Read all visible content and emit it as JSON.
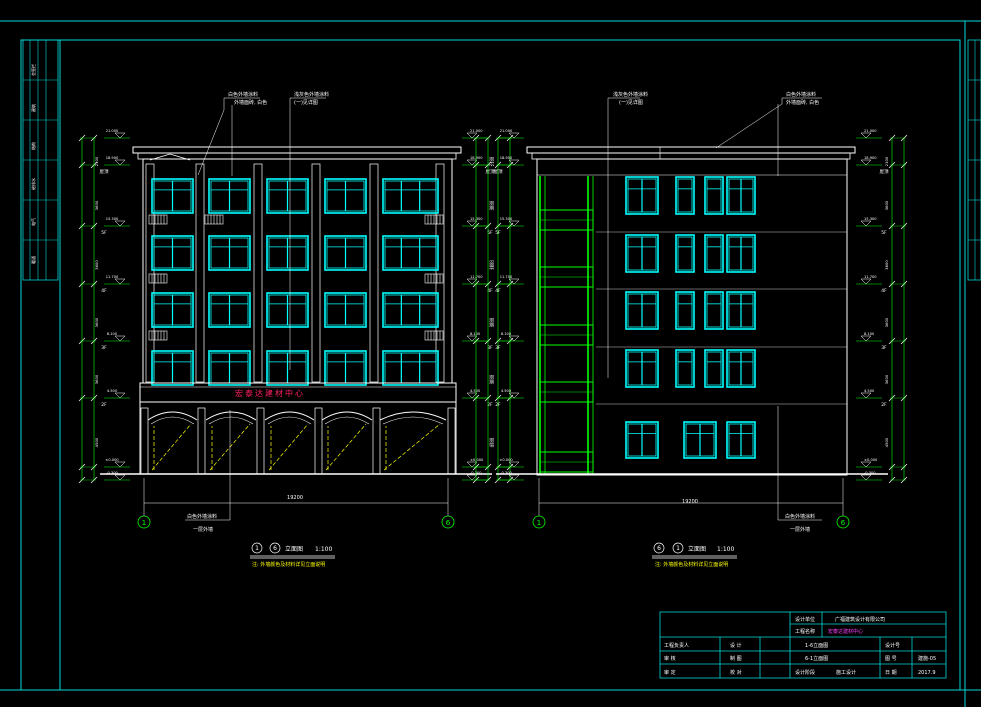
{
  "colors": {
    "background": "#000000",
    "frame": "#00d8d8",
    "outline": "#ffffff",
    "window": "#00ffff",
    "green": "#00ff00",
    "yellow": "#ffff00",
    "red": "#ff2060",
    "magenta": "#ff40ff"
  },
  "front": {
    "sign": "宏泰达建材中心",
    "axis_left": "1",
    "axis_right": "6",
    "total_dim": "19200",
    "title_left": "1",
    "title_right": "6",
    "title_suffix": "立面图",
    "scale": "1:100",
    "note": "注: 外墙颜色及材料详见立面说明",
    "callout_1": "白色外墙涂料",
    "callout_1b": "外墙面砖, 白色",
    "callout_2": "浅灰色外墙涂料",
    "callout_2b": "(一)见详图",
    "callout_3": "白色外墙涂料",
    "callout_3b": "一层外墙"
  },
  "rear": {
    "axis_left": "1",
    "axis_right": "6",
    "total_dim": "19200",
    "title_left": "6",
    "title_right": "1",
    "title_suffix": "立面图",
    "scale": "1:100",
    "note": "注: 外墙颜色及材料详见立面说明",
    "callout_1": "浅灰色外墙涂料",
    "callout_1b": "(一)见详图",
    "callout_2": "白色外墙涂料",
    "callout_2b": "外墙面砖, 白色",
    "callout_3": "白色外墙涂料",
    "callout_3b": "一层外墙"
  },
  "levels": [
    {
      "elev": "21.000",
      "label": ""
    },
    {
      "elev": "18.900",
      "label": "屋顶"
    },
    {
      "elev": "15.300",
      "label": "5F"
    },
    {
      "elev": "11.700",
      "label": "4F"
    },
    {
      "elev": "8.100",
      "label": "3F"
    },
    {
      "elev": "4.500",
      "label": "2F"
    },
    {
      "elev": "±0.000",
      "label": ""
    },
    {
      "elev": "-0.300",
      "label": ""
    }
  ],
  "heights": [
    "2100",
    "3600",
    "3600",
    "3600",
    "3600",
    "4500"
  ],
  "title_block": {
    "design_unit_label": "设计单位",
    "design_unit": "广福建筑设计有限公司",
    "project_label": "工程名称",
    "project": "宏泰达建材中心",
    "drawing_1": "1-6立面图",
    "drawing_2": "6-1立面图",
    "stage_label": "设计阶段",
    "stage": "施工设计",
    "rows": [
      [
        "工程负责人",
        "设  计"
      ],
      [
        "审  核",
        "制  图"
      ],
      [
        "审  定",
        "校  对"
      ]
    ],
    "no_label": "设计号",
    "sheet_label": "图  号",
    "sheet": "建施-05",
    "date_label": "日  期",
    "date": "2017.9"
  },
  "side_bar": {
    "labels": [
      "会签栏",
      "建筑",
      "结构",
      "给排水",
      "电气",
      "暖通"
    ]
  }
}
